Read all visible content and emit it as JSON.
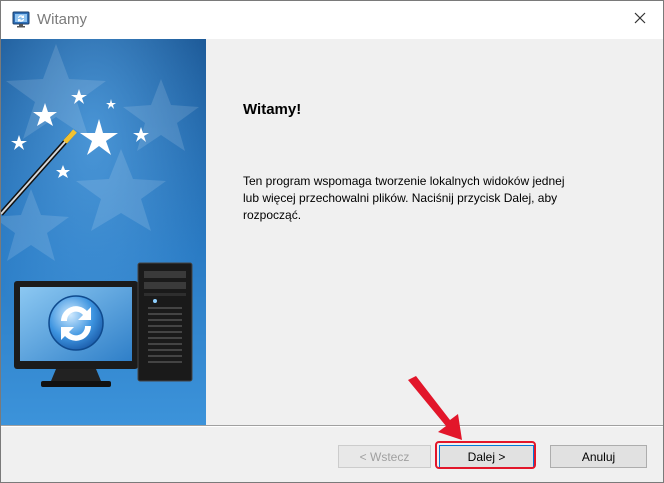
{
  "window": {
    "title": "Witamy",
    "icon": "sync-wizard-icon",
    "close_icon": "close-icon"
  },
  "banner": {
    "image": "wizard-banner-computer-sync",
    "colors": {
      "top": "#1f5f9e",
      "bottom": "#3a8fd6",
      "star": "#ffffff"
    }
  },
  "content": {
    "heading": "Witamy!",
    "body": "Ten program wspomaga tworzenie lokalnych widoków jednej lub więcej przechowalni plików. Naciśnij przycisk Dalej, aby rozpocząć."
  },
  "buttons": {
    "back": {
      "label": "< Wstecz",
      "enabled": false
    },
    "next": {
      "label": "Dalej >",
      "enabled": true
    },
    "cancel": {
      "label": "Anuluj",
      "enabled": true
    }
  },
  "annotation": {
    "color": "#e2162a",
    "target": "next-button"
  }
}
